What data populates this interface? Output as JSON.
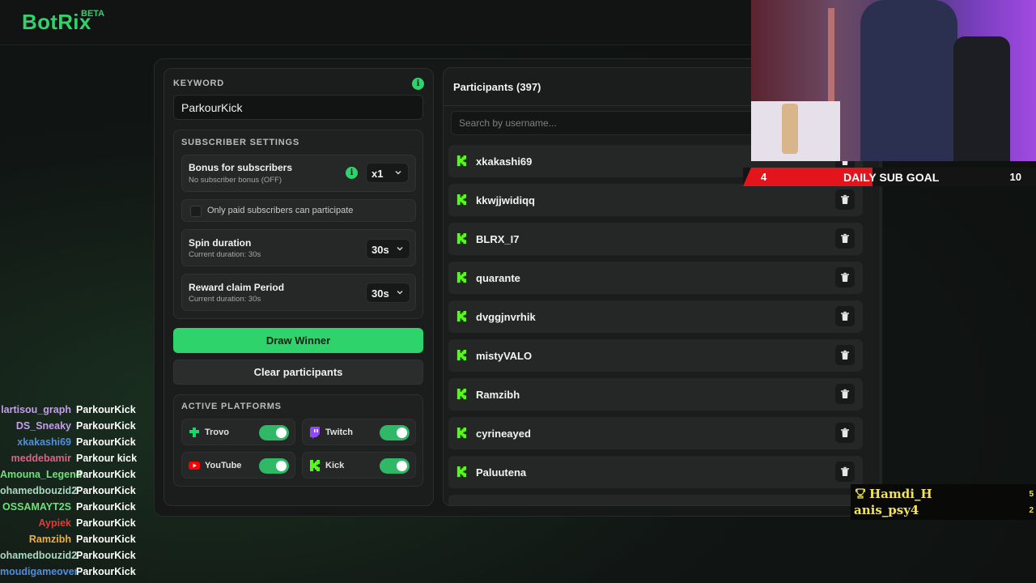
{
  "app": {
    "logo": "BotRix",
    "badge": "BETA"
  },
  "keyword": {
    "label": "KEYWORD",
    "value": "ParkourKick"
  },
  "subscriber_settings": {
    "label": "SUBSCRIBER SETTINGS",
    "bonus": {
      "title": "Bonus for subscribers",
      "subtitle": "No subscriber bonus (OFF)",
      "selected": "x1"
    },
    "only_paid": {
      "label": "Only paid subscribers can participate",
      "checked": false
    },
    "spin": {
      "title": "Spin duration",
      "subtitle": "Current duration: 30s",
      "selected": "30s"
    },
    "reward": {
      "title": "Reward claim Period",
      "subtitle": "Current duration: 30s",
      "selected": "30s"
    }
  },
  "actions": {
    "draw": "Draw Winner",
    "clear": "Clear participants"
  },
  "platforms": {
    "label": "ACTIVE PLATFORMS",
    "items": [
      {
        "name": "Trovo",
        "icon": "trovo-icon",
        "enabled": true
      },
      {
        "name": "Twitch",
        "icon": "twitch-icon",
        "enabled": true
      },
      {
        "name": "YouTube",
        "icon": "youtube-icon",
        "enabled": true
      },
      {
        "name": "Kick",
        "icon": "kick-icon",
        "enabled": true
      }
    ]
  },
  "participants": {
    "title": "Participants (397)",
    "search_placeholder": "Search by username...",
    "items": [
      "xkakashi69",
      "kkwjjwidiqq",
      "BLRX_I7",
      "quarante",
      "dvggjnvrhik",
      "mistyVALO",
      "Ramzibh",
      "cyrineayed",
      "Paluutena"
    ]
  },
  "stream_overlay": {
    "sub_goal": {
      "current": "4",
      "label": "DAILY SUB GOAL",
      "target": "10"
    },
    "leaderboard": [
      {
        "name": "Hamdi_H",
        "count": "5"
      },
      {
        "name": "anis_psy4",
        "count": "2"
      }
    ]
  },
  "chat": [
    {
      "user": "lartisou_graph",
      "message": "ParkourKick",
      "color": "#c59cf0"
    },
    {
      "user": "DS_Sneaky",
      "message": "ParkourKick",
      "color": "#c59cf0"
    },
    {
      "user": "xkakashi69",
      "message": "ParkourKick",
      "color": "#4e8fe0"
    },
    {
      "user": "meddebamir",
      "message": "Parkour kick",
      "color": "#e0608a"
    },
    {
      "user": "Amouna_Legend",
      "message": "ParkourKick",
      "color": "#6fe07a"
    },
    {
      "user": "ohamedbouzid2",
      "message": "ParkourKick",
      "color": "#a8d8c0"
    },
    {
      "user": "OSSAMAYT2S",
      "message": "ParkourKick",
      "color": "#6fe07a"
    },
    {
      "user": "Aypiek",
      "message": "ParkourKick",
      "color": "#e03a3a"
    },
    {
      "user": "Ramzibh",
      "message": "ParkourKick",
      "color": "#f0b040"
    },
    {
      "user": "ohamedbouzid2",
      "message": "ParkourKick",
      "color": "#a8d8c0"
    },
    {
      "user": "moudigameover",
      "message": "ParkourKick",
      "color": "#4e8fe0"
    }
  ],
  "colors": {
    "accent": "#2fd36b",
    "background": "#101512",
    "panel": "#1b1d1c",
    "goal_red": "#e4141c",
    "leaderboard_gold": "#f1e45a"
  }
}
